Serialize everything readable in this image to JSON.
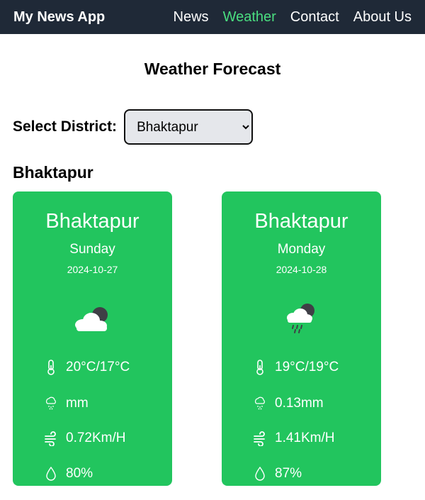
{
  "nav": {
    "brand": "My News App",
    "links": [
      {
        "label": "News",
        "active": false
      },
      {
        "label": "Weather",
        "active": true
      },
      {
        "label": "Contact",
        "active": false
      },
      {
        "label": "About Us",
        "active": false
      }
    ],
    "active_color": "#4ade80",
    "background": "#1f2937"
  },
  "page": {
    "title": "Weather Forecast",
    "district_label": "Select District:",
    "district_selected": "Bhaktapur",
    "district_heading": "Bhaktapur"
  },
  "cards": [
    {
      "city": "Bhaktapur",
      "day": "Sunday",
      "date": "2024-10-27",
      "condition_icon": "cloudy-night-icon",
      "temperature": "20°C/17°C",
      "precipitation": "mm",
      "wind": "0.72Km/H",
      "humidity": "80%"
    },
    {
      "city": "Bhaktapur",
      "day": "Monday",
      "date": "2024-10-28",
      "condition_icon": "night-rain-icon",
      "temperature": "19°C/19°C",
      "precipitation": "0.13mm",
      "wind": "1.41Km/H",
      "humidity": "87%"
    }
  ],
  "colors": {
    "card": "#22c55e",
    "card_text": "#ffffff"
  }
}
